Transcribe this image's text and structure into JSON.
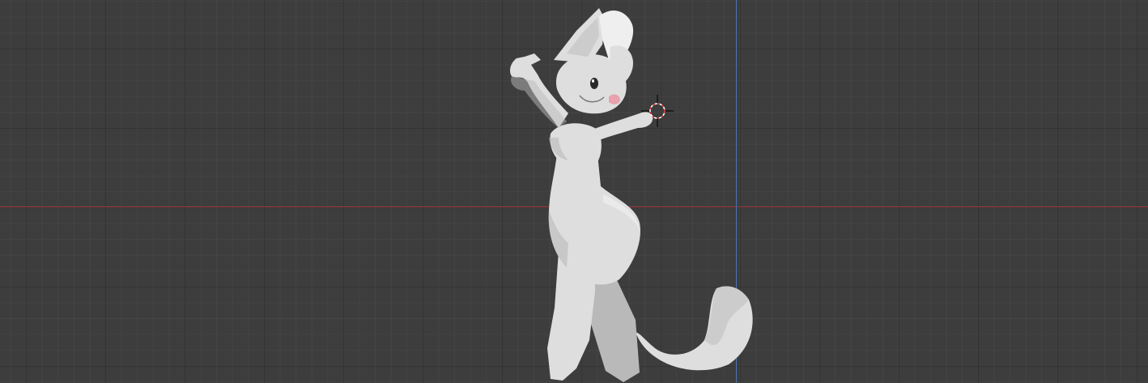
{
  "viewport": {
    "background": "#3d3d3d",
    "grid": "on",
    "x_axis_color": "#a33a42",
    "y_axis_color": "#4a76b0"
  },
  "model": {
    "kind": "cartoon cat character, posed, grey solid shading",
    "base_color": "#dedede",
    "shadow_color": "#b9b9b9",
    "highlight_color": "#efefef",
    "eye_color": "#2a2a2a",
    "tongue_color": "#e7a2ad"
  },
  "cursor_3d": {
    "icon": "3d-cursor-icon",
    "ring_colors": [
      "#d84848",
      "#ffffff"
    ],
    "crosshair_color": "#111111"
  }
}
